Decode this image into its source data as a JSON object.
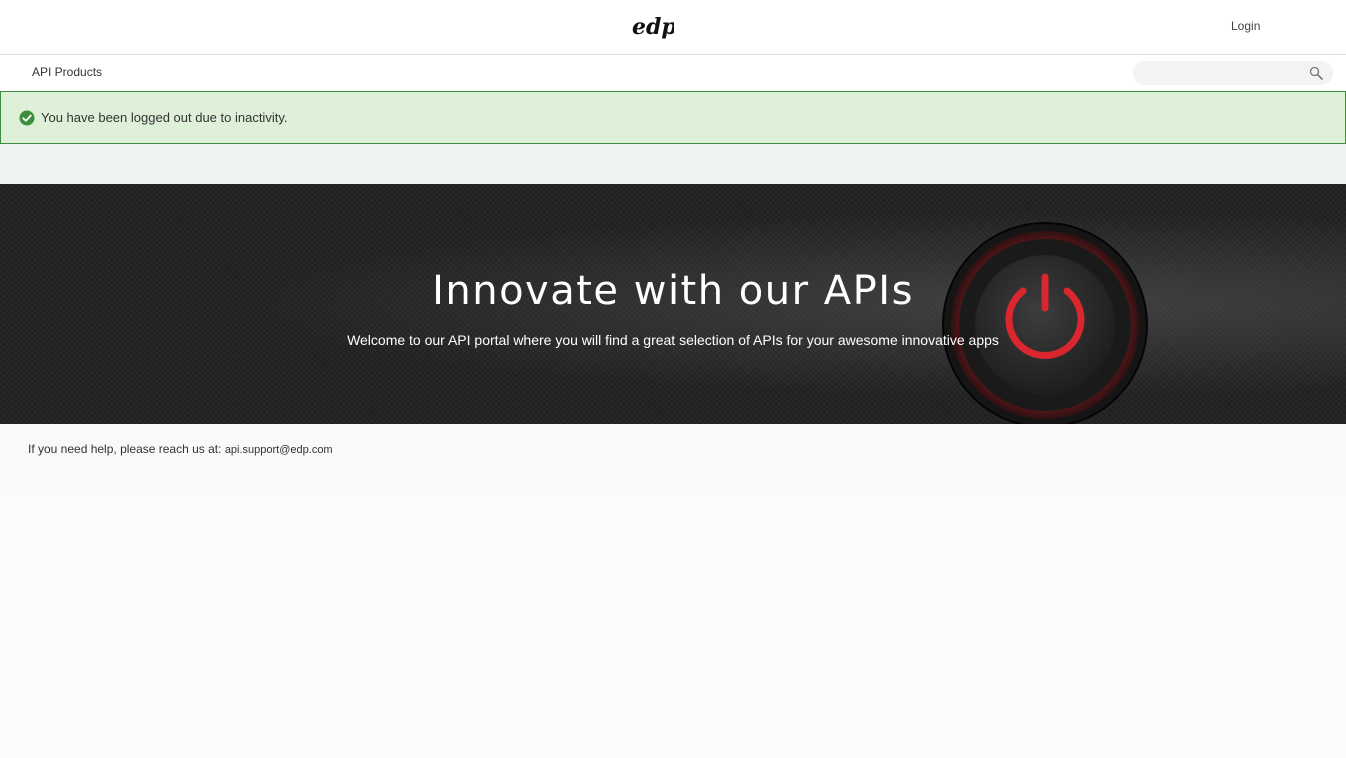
{
  "header": {
    "logo_text": "edp",
    "login_label": "Login"
  },
  "nav": {
    "api_products_label": "API Products",
    "search_value": "",
    "search_placeholder": ""
  },
  "alert": {
    "message": "You have been logged out due to inactivity.",
    "icon": "check-circle-icon",
    "color": "#3c8d3c"
  },
  "hero": {
    "title": "Innovate with our APIs",
    "subtitle": "Welcome to our API portal where you will find a great selection of APIs for your awesome innovative apps",
    "icon": "power-icon",
    "accent_color": "#d9262f"
  },
  "footer": {
    "help_prefix": "If you need help, please reach us at: ",
    "support_email": "api.support@edp.com"
  }
}
